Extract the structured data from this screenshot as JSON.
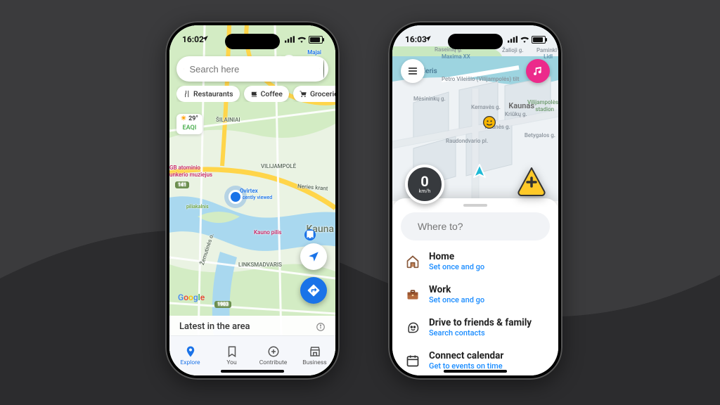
{
  "left": {
    "status_time": "16:02",
    "search_placeholder": "Search here",
    "chips": [
      "Restaurants",
      "Coffee",
      "Groceries"
    ],
    "weather_temp": "29°",
    "weather_sub": "EAQI",
    "map_labels": {
      "majai": "Majai",
      "recently": "Recently viewed",
      "silainiai": "ŠILAINIAI",
      "vilijampole": "VILIJAMPOLĖ",
      "museum1": "GB atominio",
      "museum2": "unkerio muziejus",
      "ovirtex": "Ovirtex",
      "ovirtex_sub": "ecently viewed",
      "kauno": "Kauno pilis",
      "kaunas": "Kauna",
      "lmadvaris": "LINKSMADVARIS",
      "neries": "Neries krant",
      "zemutines": "Žemutinės o.",
      "piliakalnis": "piliakalnis",
      "road_1903": "1903",
      "road_141": "141"
    },
    "sheet_title": "Latest in the area",
    "tabs": [
      "Explore",
      "You",
      "Contribute",
      "Business"
    ],
    "google": "Google"
  },
  "right": {
    "status_time": "16:03",
    "map_labels": {
      "rasieniu": "Raseinių g.",
      "zalioji": "Žalioji g.",
      "paminki": "Paminkl",
      "neris": "Neris",
      "bridge": "Petro Vileišio (Vilijampolės) tilt",
      "mesininku": "Mėsininkų g.",
      "kernaves": "Kernavės g.",
      "kriukiu": "Kriūkų g.",
      "vilijampoles": "Vilijampolės",
      "stadion": "stadion",
      "torunes": "Torunės g.",
      "betygalos": "Betygalos g.",
      "raudondvario": "Raudondvario pl.",
      "kaunas": "Kaunas",
      "maxima": "Maxima XX",
      "lidl": "Lidl"
    },
    "speed_value": "0",
    "speed_unit": "km/h",
    "search_placeholder": "Where to?",
    "destinations": [
      {
        "title": "Home",
        "sub": "Set once and go"
      },
      {
        "title": "Work",
        "sub": "Set once and go"
      },
      {
        "title": "Drive to friends & family",
        "sub": "Search contacts"
      },
      {
        "title": "Connect calendar",
        "sub": "Get to events on time"
      }
    ]
  }
}
